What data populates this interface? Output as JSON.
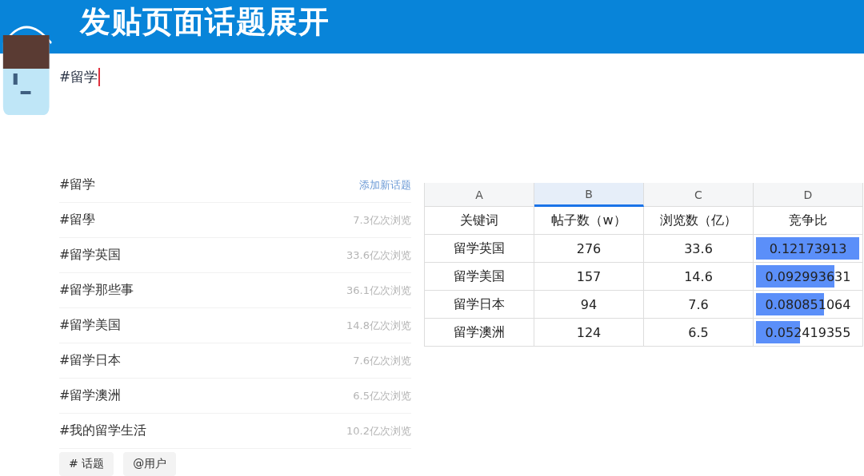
{
  "header": {
    "title": "发贴页面话题展开"
  },
  "composer": {
    "value": "#留学"
  },
  "topics": {
    "query": "#留学",
    "action": "添加新话题",
    "items": [
      {
        "name": "#留學",
        "views": "7.3亿次浏览"
      },
      {
        "name": "#留学英国",
        "views": "33.6亿次浏览"
      },
      {
        "name": "#留学那些事",
        "views": "36.1亿次浏览"
      },
      {
        "name": "#留学美国",
        "views": "14.8亿次浏览"
      },
      {
        "name": "#留学日本",
        "views": "7.6亿次浏览"
      },
      {
        "name": "#留学澳洲",
        "views": "6.5亿次浏览"
      },
      {
        "name": "#我的留学生活",
        "views": "10.2亿次浏览"
      }
    ]
  },
  "toolbar": [
    "# 话题",
    "@用户"
  ],
  "sheet": {
    "columns": [
      {
        "label": "A",
        "selected": false
      },
      {
        "label": "B",
        "selected": true
      },
      {
        "label": "C",
        "selected": false
      },
      {
        "label": "D",
        "selected": false
      }
    ],
    "header": [
      "关键词",
      "帖子数（w）",
      "浏览数（亿）",
      "竞争比"
    ],
    "rows": [
      {
        "keyword": "留学英国",
        "posts": "276",
        "views": "33.6",
        "ratio": "0.12173913",
        "level": 1
      },
      {
        "keyword": "留学美国",
        "posts": "157",
        "views": "14.6",
        "ratio": "0.092993631",
        "level": 0.76
      },
      {
        "keyword": "留学日本",
        "posts": "94",
        "views": "7.6",
        "ratio": "0.080851064",
        "level": 0.66
      },
      {
        "keyword": "留学澳洲",
        "posts": "124",
        "views": "6.5",
        "ratio": "0.052419355",
        "level": 0.43
      }
    ]
  }
}
